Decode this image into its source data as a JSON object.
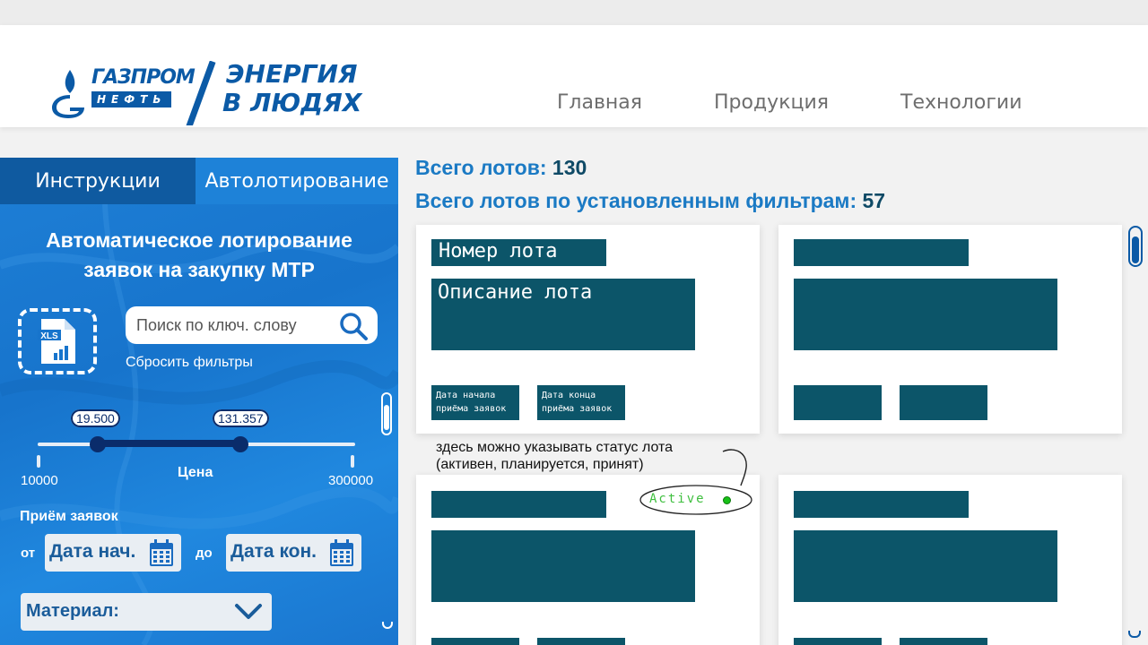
{
  "header": {
    "logo": {
      "brand_top": "ГАЗПРОМ",
      "brand_bottom": "НЕФТЬ",
      "slogan_line1": "ЭНЕРГИЯ",
      "slogan_line2": "В ЛЮДЯХ"
    },
    "nav": [
      "Главная",
      "Продукция",
      "Технологии"
    ]
  },
  "sidebar": {
    "tabs": [
      {
        "label": "Инструкции",
        "active": false
      },
      {
        "label": "Автолотирование",
        "active": true
      }
    ],
    "title_line1": "Автоматическое лотирование",
    "title_line2": "заявок на закупку МТР",
    "xls_icon_label": "XLS",
    "search": {
      "placeholder": "Поиск по ключ. слову"
    },
    "reset_label": "Сбросить фильтры",
    "price_slider": {
      "label": "Цена",
      "min": "10000",
      "max": "300000",
      "low_value": "19.500",
      "high_value": "131.357"
    },
    "receipt": {
      "label": "Приём заявок",
      "from_label": "от",
      "to_label": "до",
      "from_value": "Дата нач.",
      "to_value": "Дата кон."
    },
    "material_label": "Материал:"
  },
  "main": {
    "total_lots_label": "Всего лотов:",
    "total_lots_value": "130",
    "filtered_lots_label": "Всего лотов по установленным фильтрам:",
    "filtered_lots_value": "57",
    "card_template": {
      "lot_number": "Номер лота",
      "lot_description": "Описание лота",
      "start_date": "Дата начала приёма заявок",
      "end_date": "Дата конца приёма заявок"
    },
    "annotation": "здесь можно указывать статус лота (активен, планируется, принят)",
    "status_badge": "Active"
  },
  "colors": {
    "brand_blue": "#0b5aa6",
    "sidebar_blue": "#1774cc",
    "card_block": "#0c5569",
    "count_text": "#1b7ac4",
    "status_green": "#17c017"
  }
}
